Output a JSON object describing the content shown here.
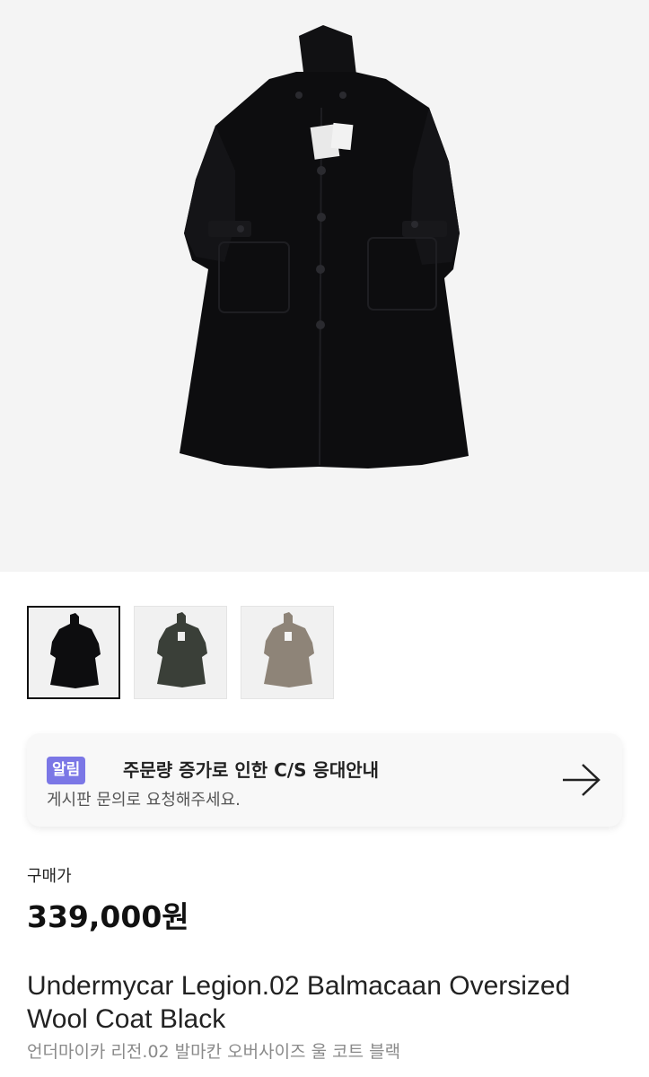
{
  "product": {
    "main_image_icon": "wool-coat-black-image",
    "thumbnails": [
      {
        "icon": "coat-thumbnail-black",
        "color": "#0d0d0f",
        "selected": true
      },
      {
        "icon": "coat-thumbnail-dark-green",
        "color": "#3a3f38",
        "selected": false
      },
      {
        "icon": "coat-thumbnail-taupe",
        "color": "#8e8478",
        "selected": false
      }
    ],
    "price_label": "구매가",
    "price": "339,000원",
    "title_en": "Undermycar Legion.02 Balmacaan Oversized Wool Coat Black",
    "title_ko": "언더마이카 리전.02 발마칸 오버사이즈 울 코트 블랙"
  },
  "notice": {
    "badge": "알림",
    "title": "주문량 증가로 인한 C/S 응대안내",
    "subtitle": "게시판 문의로 요청해주세요.",
    "arrow_icon": "arrow-right-icon",
    "badge_color": "#7b77e6"
  }
}
